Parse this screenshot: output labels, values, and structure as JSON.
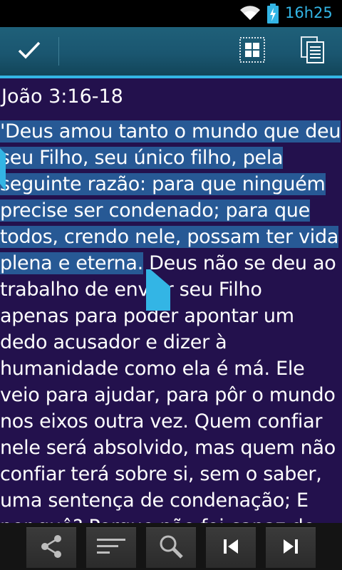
{
  "status_bar": {
    "time": "16h25",
    "wifi_icon": "wifi-icon",
    "battery_icon": "battery-charging-icon"
  },
  "action_bar": {
    "done_icon": "checkmark-icon",
    "select_all_icon": "select-all-icon",
    "copy_icon": "copy-icon"
  },
  "content": {
    "reference": "João 3:16-18",
    "lines": [
      {
        "sel": "'Deus amou tanto o mundo que deu",
        "rest": ""
      },
      {
        "sel": "seu Filho, seu único filho, pela",
        "rest": ""
      },
      {
        "sel": "seguinte razão: para que ninguém",
        "rest": ""
      },
      {
        "sel": "precise ser condenado; para que",
        "rest": ""
      },
      {
        "sel": "todos, crendo nele, possam ter vida",
        "rest": ""
      },
      {
        "sel": "plena e eterna.",
        "rest": " Deus não se deu ao"
      },
      {
        "sel": "",
        "rest": "trabalho de enviar seu Filho"
      },
      {
        "sel": "",
        "rest": "apenas para poder apontar um"
      },
      {
        "sel": "",
        "rest": "dedo acusador e dizer à"
      },
      {
        "sel": "",
        "rest": "humanidade como ela é má. Ele"
      },
      {
        "sel": "",
        "rest": "veio para ajudar, para pôr o mundo"
      },
      {
        "sel": "",
        "rest": "nos eixos outra vez. Quem confiar"
      },
      {
        "sel": "",
        "rest": "nele será absolvido, mas quem não"
      },
      {
        "sel": "",
        "rest": "confiar terá sobre si, sem o saber,"
      },
      {
        "sel": "",
        "rest": "uma sentença de condenação; E"
      },
      {
        "sel": "",
        "rest": "por quê? Porque não foi capaz de"
      }
    ]
  },
  "bottom_bar": {
    "buttons": [
      "share-icon",
      "sort-lines-icon",
      "search-icon",
      "skip-previous-icon",
      "skip-next-icon"
    ]
  },
  "colors": {
    "background": "#23114d",
    "selection": "#275995",
    "accent": "#33b5e5",
    "action_bar": "#1a5670",
    "handle": "#33b5e5"
  }
}
